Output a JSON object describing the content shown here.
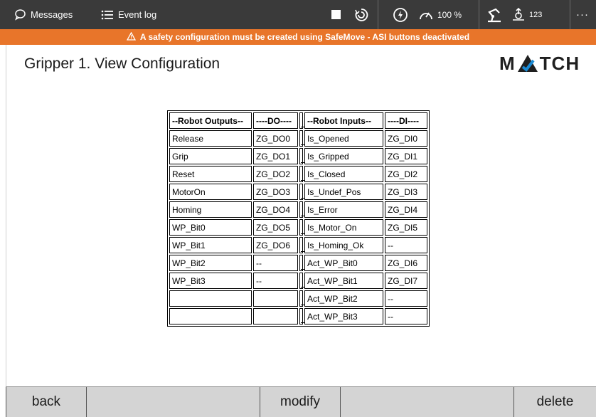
{
  "topbar": {
    "messages_label": "Messages",
    "eventlog_label": "Event log",
    "speed_value": "100 %",
    "tool_count": "123",
    "more_label": "···",
    "icons": [
      "chat-icon",
      "list-icon",
      "stop-icon",
      "run-mode-icon",
      "power-icon",
      "speed-gauge-icon",
      "robot-icon",
      "workobject-icon",
      "more-icon"
    ]
  },
  "warning": {
    "icon": "warning-triangle-icon",
    "text": "A safety configuration must be created using SafeMove - ASI buttons deactivated",
    "color": "#e8752a"
  },
  "page": {
    "title": "Gripper 1. View Configuration",
    "logo_text_left": "M",
    "logo_text_right": "TCH",
    "logo_accent": "#1a8ad4"
  },
  "table": {
    "headers": [
      "--Robot Outputs--",
      "----DO----",
      "",
      "--Robot Inputs--",
      "----DI----"
    ],
    "rows": [
      [
        "Release",
        "ZG_DO0",
        "_",
        "Is_Opened",
        "ZG_DI0"
      ],
      [
        "Grip",
        "ZG_DO1",
        "_",
        "Is_Gripped",
        "ZG_DI1"
      ],
      [
        "Reset",
        "ZG_DO2",
        "_",
        "Is_Closed",
        "ZG_DI2"
      ],
      [
        "MotorOn",
        "ZG_DO3",
        "_",
        "Is_Undef_Pos",
        "ZG_DI3"
      ],
      [
        "Homing",
        "ZG_DO4",
        "_",
        "Is_Error",
        "ZG_DI4"
      ],
      [
        "WP_Bit0",
        "ZG_DO5",
        "_",
        "Is_Motor_On",
        "ZG_DI5"
      ],
      [
        "WP_Bit1",
        "ZG_DO6",
        "_",
        "Is_Homing_Ok",
        "--"
      ],
      [
        "WP_Bit2",
        "--",
        "_",
        "Act_WP_Bit0",
        "ZG_DI6"
      ],
      [
        "WP_Bit3",
        "--",
        "_",
        "Act_WP_Bit1",
        "ZG_DI7"
      ],
      [
        "",
        "",
        "_",
        "Act_WP_Bit2",
        "--"
      ],
      [
        "",
        "",
        "_",
        "Act_WP_Bit3",
        "--"
      ]
    ]
  },
  "bottom": {
    "back_label": "back",
    "modify_label": "modify",
    "delete_label": "delete"
  }
}
